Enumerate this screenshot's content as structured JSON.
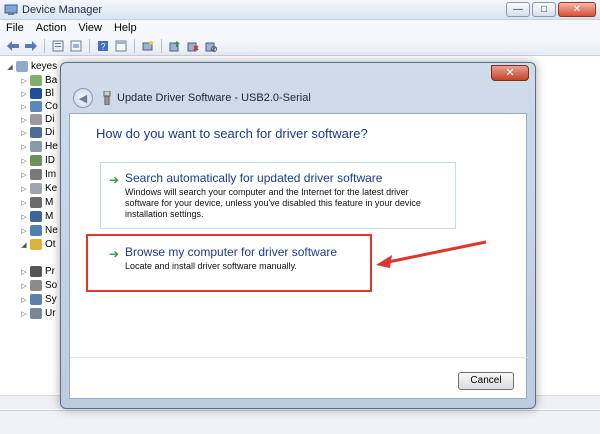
{
  "window": {
    "title": "Device Manager",
    "caption": {
      "minimize": "—",
      "maximize": "□",
      "close": "✕"
    }
  },
  "menu": {
    "items": [
      "File",
      "Action",
      "View",
      "Help"
    ]
  },
  "toolbar": {
    "icons": [
      "back-arrow-icon",
      "forward-arrow-icon",
      "properties-icon",
      "device-list-icon",
      "help-icon",
      "view-icon",
      "scan-hardware-icon",
      "update-driver-icon",
      "uninstall-icon",
      "disable-icon"
    ]
  },
  "tree": {
    "root": "keyes",
    "items": [
      "Ba",
      "Bl",
      "Co",
      "Di",
      "Di",
      "He",
      "ID",
      "Im",
      "Ke",
      "M",
      "M",
      "Ne",
      "Ot",
      "Pr",
      "So",
      "Sy",
      "Ur"
    ]
  },
  "dialog": {
    "title": "Update Driver Software - USB2.0-Serial",
    "question": "How do you want to search for driver software?",
    "option_auto": {
      "title": "Search automatically for updated driver software",
      "desc": "Windows will search your computer and the Internet for the latest driver software for your device, unless you've disabled this feature in your device installation settings."
    },
    "option_browse": {
      "title": "Browse my computer for driver software",
      "desc": "Locate and install driver software manually."
    },
    "cancel_label": "Cancel",
    "close_glyph": "✕",
    "option_arrow_glyph": "➔",
    "back_glyph": "◀"
  },
  "colors": {
    "accent_blue": "#1e3a8a",
    "highlight_red": "#e0352c",
    "arrow_green": "#2d9a3c"
  }
}
